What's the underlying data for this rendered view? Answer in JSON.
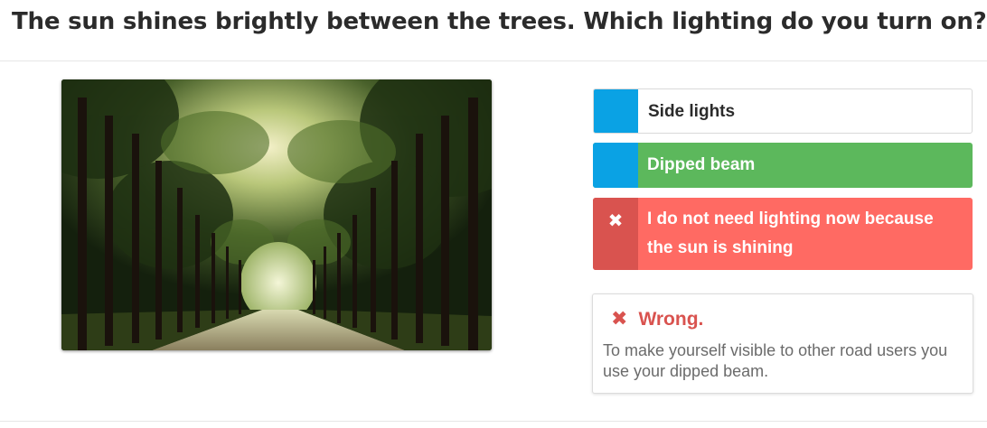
{
  "question": "The sun shines brightly between the trees. Which lighting do you turn on?",
  "answers": [
    {
      "label": "Side lights"
    },
    {
      "label": "Dipped beam"
    },
    {
      "label": "I do not need lighting now because the sun is shining",
      "marker_icon": "close-icon"
    }
  ],
  "feedback": {
    "icon": "close-icon",
    "title": "Wrong.",
    "text": "To make yourself visible to other road users you use your dipped beam."
  },
  "colors": {
    "marker_blue": "#0aa2e4",
    "correct_green": "#5cb85c",
    "wrong_red": "#ff6a63",
    "wrong_red_dark": "#d9534f"
  }
}
